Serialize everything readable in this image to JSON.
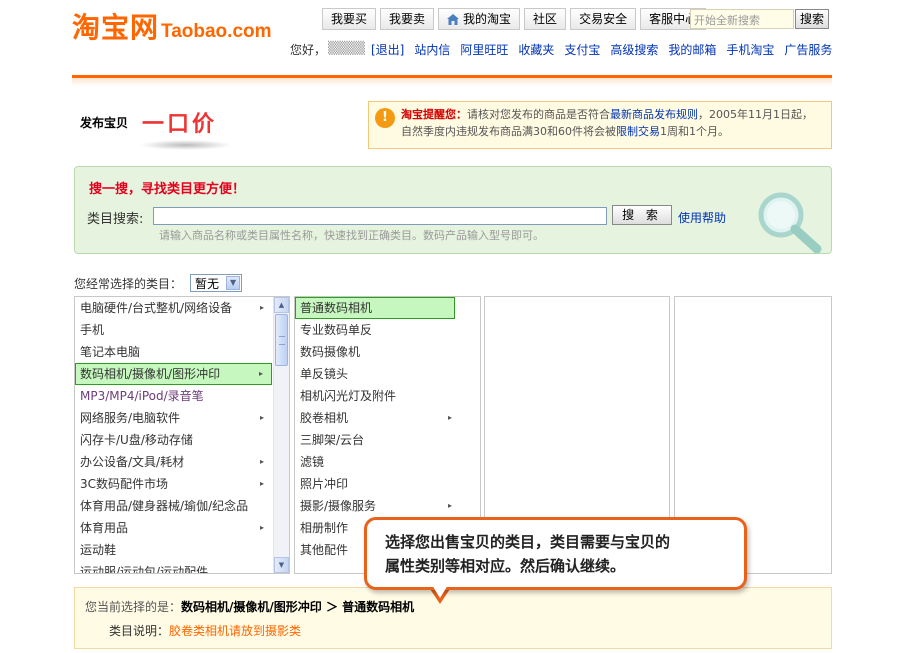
{
  "header": {
    "logo_cn": "淘宝网",
    "logo_en": "Taobao.com",
    "nav": [
      "我要买",
      "我要卖",
      "我的淘宝",
      "社区",
      "交易安全",
      "客服中心"
    ],
    "search_placeholder": "开始全新搜索",
    "search_button": "搜索",
    "greeting": "您好，",
    "username": "▒▒▒▒",
    "logout": "[退出]",
    "links": [
      "站内信",
      "阿里旺旺",
      "收藏夹",
      "支付宝",
      "高级搜索",
      "我的邮箱",
      "手机淘宝",
      "广告服务"
    ]
  },
  "title": {
    "publish_label": "发布宝贝",
    "mode": "一口价"
  },
  "reminder": {
    "title": "淘宝提醒您：",
    "text1": "请核对您发布的商品是否符合",
    "link1": "最新商品发布规则",
    "text2": "，2005年11月1日起，自然季度内违规发布商品满30和60件将会被",
    "link2": "限制交易",
    "text3": "1周和1个月。"
  },
  "search_panel": {
    "title": "搜一搜，寻找类目更方便！",
    "label": "类目搜索:",
    "input_value": "",
    "button": "搜 索",
    "help": "使用帮助",
    "hint": "请输入商品名称或类目属性名称，快速找到正确类目。数码产品输入型号即可。"
  },
  "common": {
    "label": "您经常选择的类目：",
    "selected": "暂无"
  },
  "columns": {
    "col1": [
      {
        "label": "电脑硬件/台式整机/网络设备",
        "arrow": "▸"
      },
      {
        "label": "手机",
        "arrow": ""
      },
      {
        "label": "笔记本电脑",
        "arrow": ""
      },
      {
        "label": "数码相机/摄像机/图形冲印",
        "arrow": "▸"
      },
      {
        "label": "MP3/MP4/iPod/录音笔",
        "arrow": ""
      },
      {
        "label": "网络服务/电脑软件",
        "arrow": "▸"
      },
      {
        "label": "闪存卡/U盘/移动存储",
        "arrow": ""
      },
      {
        "label": "办公设备/文具/耗材",
        "arrow": "▸"
      },
      {
        "label": "3C数码配件市场",
        "arrow": "▸"
      },
      {
        "label": "体育用品/健身器械/瑜伽/纪念品",
        "arrow": ""
      },
      {
        "label": "体育用品",
        "arrow": "▸"
      },
      {
        "label": "运动鞋",
        "arrow": ""
      },
      {
        "label": "运动服/运动包/运动配件",
        "arrow": ""
      }
    ],
    "col2": [
      {
        "label": "普通数码相机",
        "arrow": ""
      },
      {
        "label": "专业数码单反",
        "arrow": ""
      },
      {
        "label": "数码摄像机",
        "arrow": ""
      },
      {
        "label": "单反镜头",
        "arrow": ""
      },
      {
        "label": "相机闪光灯及附件",
        "arrow": ""
      },
      {
        "label": "胶卷相机",
        "arrow": "▸"
      },
      {
        "label": "三脚架/云台",
        "arrow": ""
      },
      {
        "label": "滤镜",
        "arrow": ""
      },
      {
        "label": "照片冲印",
        "arrow": ""
      },
      {
        "label": "摄影/摄像服务",
        "arrow": "▸"
      },
      {
        "label": "相册制作",
        "arrow": ""
      },
      {
        "label": "其他配件",
        "arrow": ""
      }
    ]
  },
  "current": {
    "prefix": "您当前选择的是：",
    "path": "数码相机/摄像机/图形冲印 ＞ 普通数码相机",
    "desc_label": "类目说明：",
    "desc_value": "胶卷类相机请放到摄影类"
  },
  "callout": {
    "line1": "选择您出售宝贝的类目，类目需要与宝贝的",
    "line2": "属性类别等相对应。然后确认继续。"
  }
}
